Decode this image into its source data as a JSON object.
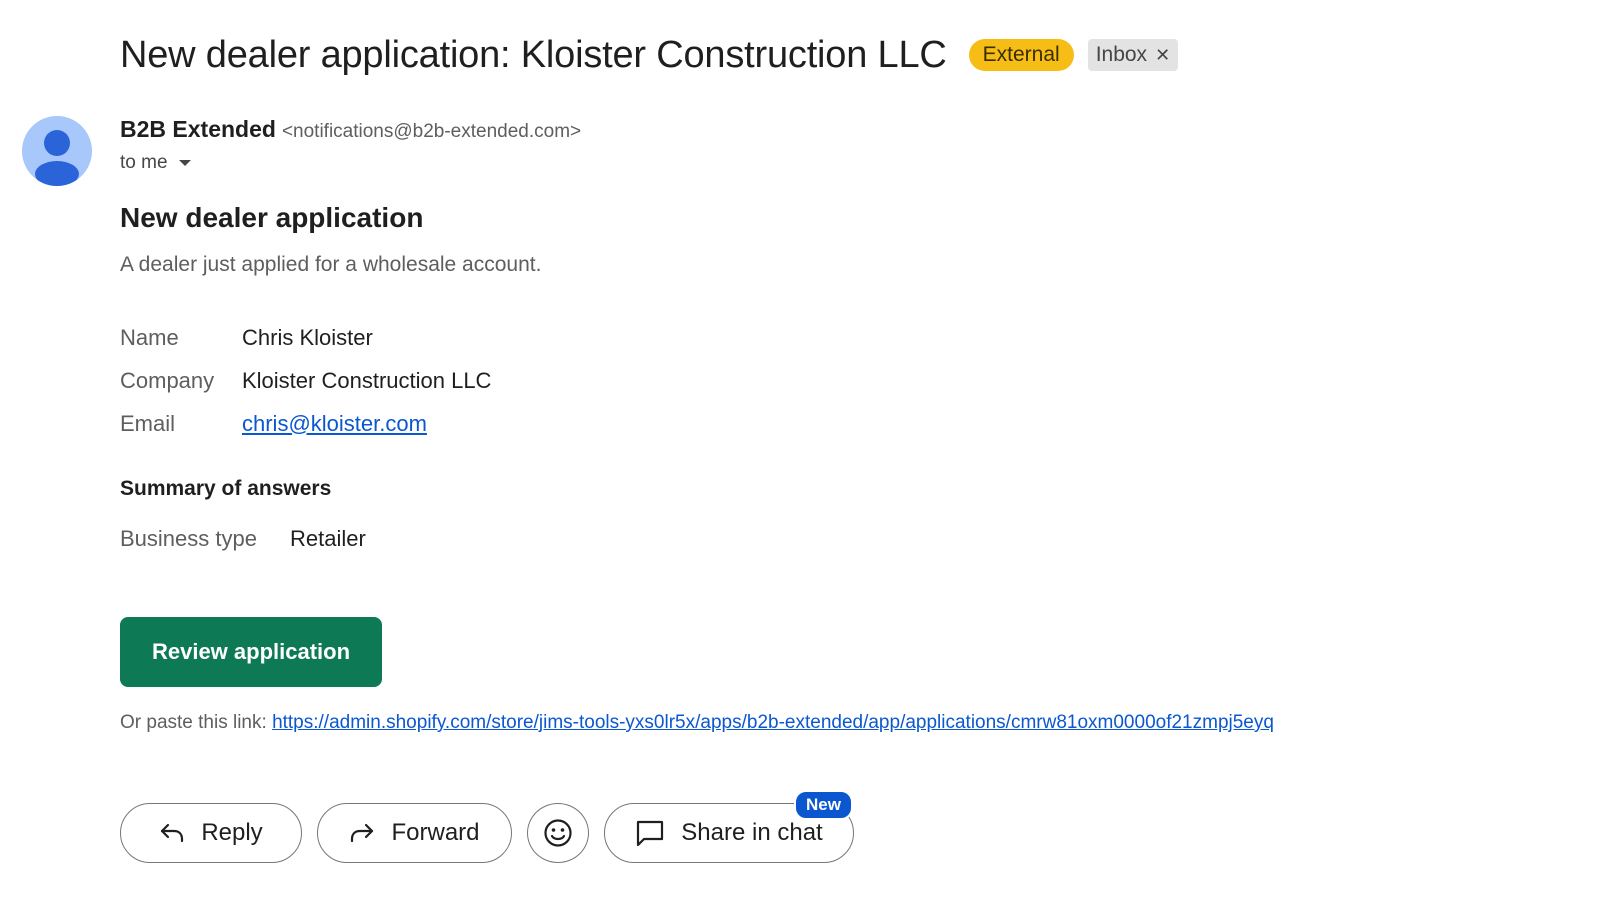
{
  "email": {
    "subject": "New dealer application: Kloister Construction LLC",
    "labels": {
      "external": "External",
      "inbox": "Inbox"
    },
    "sender": {
      "name": "B2B Extended",
      "address": "<notifications@b2b-extended.com>"
    },
    "recipient_text": "to me"
  },
  "message": {
    "heading": "New dealer application",
    "intro": "A dealer just applied for a wholesale account.",
    "details": [
      {
        "label": "Name",
        "value": "Chris Kloister"
      },
      {
        "label": "Company",
        "value": "Kloister Construction LLC"
      },
      {
        "label": "Email",
        "value": "chris@kloister.com"
      }
    ],
    "summary_heading": "Summary of answers",
    "answers": [
      {
        "label": "Business type",
        "value": "Retailer"
      }
    ],
    "review_button": "Review application",
    "paste_prefix": "Or paste this link: ",
    "paste_link": "https://admin.shopify.com/store/jims-tools-yxs0lr5x/apps/b2b-extended/app/applications/cmrw81oxm0000of21zmpj5eyq"
  },
  "actions": {
    "reply": "Reply",
    "forward": "Forward",
    "share": "Share in chat",
    "share_badge": "New"
  },
  "colors": {
    "external_badge": "#f6bd16",
    "review_button": "#0e7a55",
    "link": "#0b57d0",
    "avatar": "#a8c7fa"
  }
}
